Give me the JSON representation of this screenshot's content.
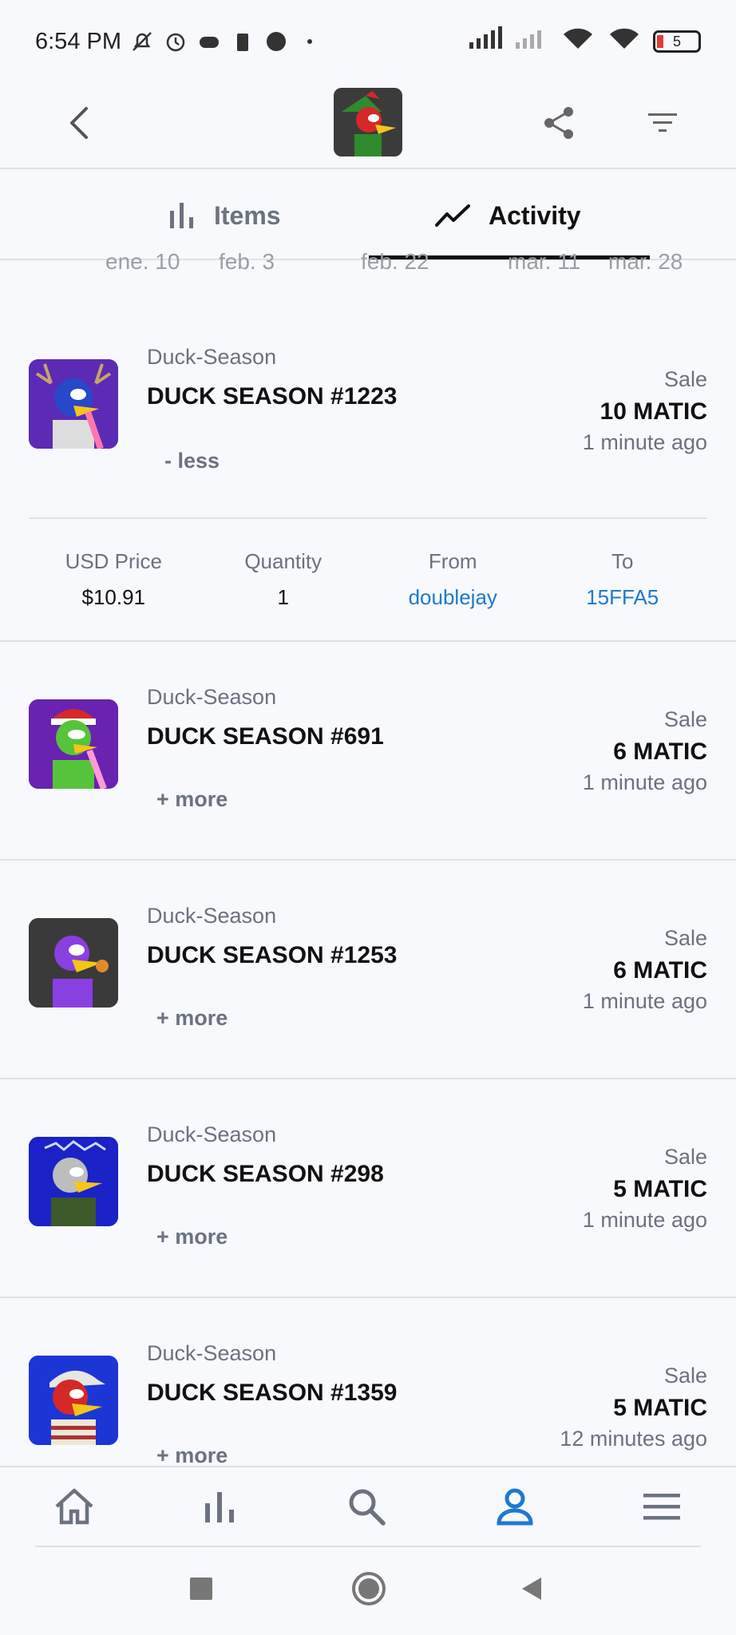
{
  "status_bar": {
    "time": "6:54 PM",
    "battery": "5"
  },
  "tabs": [
    {
      "label": "Items"
    },
    {
      "label": "Activity"
    }
  ],
  "chart_peek_labels": [
    "ene. 10",
    "feb. 3",
    "feb. 22",
    "mar. 11",
    "mar. 28"
  ],
  "activity": [
    {
      "collection": "Duck-Season",
      "name": "DUCK SEASON #1223",
      "kind": "Sale",
      "price": "10 MATIC",
      "ago": "1 minute ago",
      "toggle": "- less",
      "expanded": true,
      "details": {
        "usd_label": "USD Price",
        "usd_value": "$10.91",
        "qty_label": "Quantity",
        "qty_value": "1",
        "from_label": "From",
        "from_value": "doublejay",
        "to_label": "To",
        "to_value": "15FFA5"
      },
      "thumb_bg": "#5b2bb5"
    },
    {
      "collection": "Duck-Season",
      "name": "DUCK SEASON #691",
      "kind": "Sale",
      "price": "6 MATIC",
      "ago": "1 minute ago",
      "toggle": "+ more",
      "expanded": false,
      "thumb_bg": "#6a22b0"
    },
    {
      "collection": "Duck-Season",
      "name": "DUCK SEASON #1253",
      "kind": "Sale",
      "price": "6 MATIC",
      "ago": "1 minute ago",
      "toggle": "+ more",
      "expanded": false,
      "thumb_bg": "#3a3a3a"
    },
    {
      "collection": "Duck-Season",
      "name": "DUCK SEASON #298",
      "kind": "Sale",
      "price": "5 MATIC",
      "ago": "1 minute ago",
      "toggle": "+ more",
      "expanded": false,
      "thumb_bg": "#1a22c8"
    },
    {
      "collection": "Duck-Season",
      "name": "DUCK SEASON #1359",
      "kind": "Sale",
      "price": "5 MATIC",
      "ago": "12 minutes ago",
      "toggle": "+ more",
      "expanded": false,
      "thumb_bg": "#1c36d6"
    }
  ],
  "colors": {
    "accent": "#1e79d0",
    "muted": "#6b7280",
    "divider": "#dde1e6"
  }
}
